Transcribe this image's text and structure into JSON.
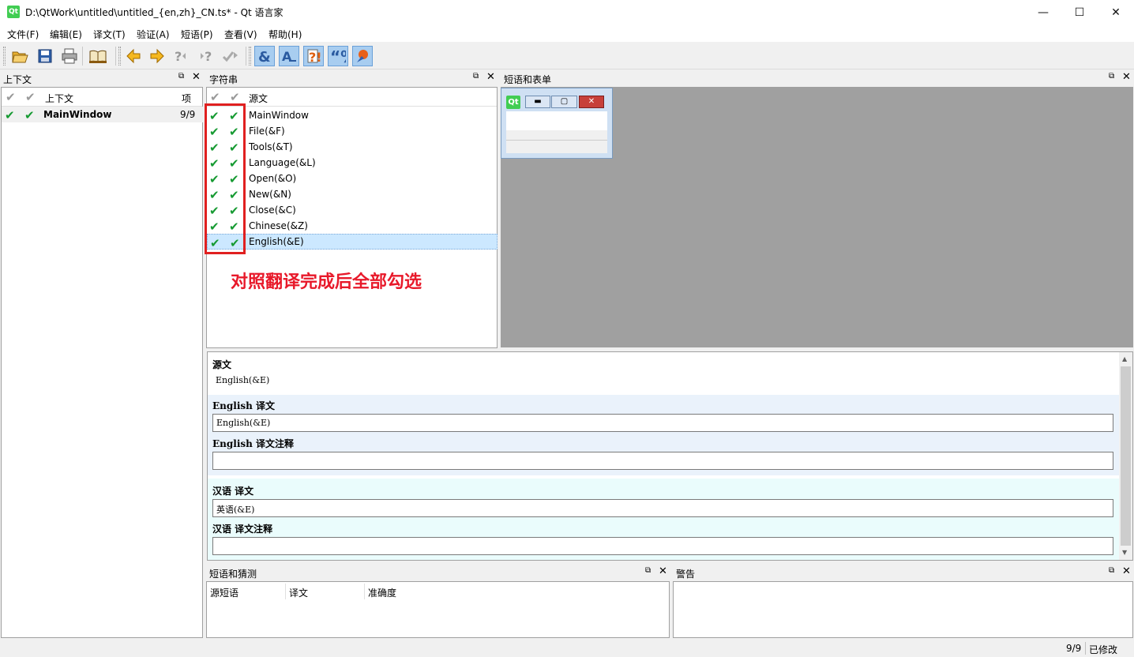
{
  "window": {
    "title": "D:\\QtWork\\untitled\\untitled_{en,zh}_CN.ts* - Qt 语言家",
    "app_icon_text": "Qt",
    "minimize": "—",
    "maximize": "☐",
    "close": "✕"
  },
  "menu": [
    "文件(F)",
    "编辑(E)",
    "译文(T)",
    "验证(A)",
    "短语(P)",
    "查看(V)",
    "帮助(H)"
  ],
  "toolbar": {
    "icons": [
      "open-icon",
      "save-icon",
      "print-icon",
      "phrasebook-icon",
      "prev-icon",
      "next-icon",
      "prev-unfinished-icon",
      "next-unfinished-icon",
      "done-next-icon",
      "accelerator-check-icon",
      "punctuation-check-icon",
      "phrase-check-icon",
      "placeholder-check-icon",
      "surrounding-whitespace-check-icon"
    ]
  },
  "context_panel": {
    "title": "上下文",
    "header_context": "上下文",
    "header_items": "项",
    "rows": [
      {
        "name": "MainWindow",
        "count": "9/9"
      }
    ]
  },
  "strings_panel": {
    "title": "字符串",
    "header_source": "源文",
    "rows": [
      "MainWindow",
      "File(&F)",
      "Tools(&T)",
      "Language(&L)",
      "Open(&O)",
      "New(&N)",
      "Close(&C)",
      "Chinese(&Z)",
      "English(&E)"
    ],
    "selected_index": 8
  },
  "annotation": "对照翻译完成后全部勾选",
  "phrases_forms": {
    "title": "短语和表单",
    "mini_icon": "Qt"
  },
  "editor": {
    "source_label": "源文",
    "source_text": "English(&E)",
    "en_translation_label": "English 译文",
    "en_translation": "English(&E)",
    "en_comment_label": "English 译文注释",
    "en_comment": "",
    "zh_translation_label": "汉语 译文",
    "zh_translation": "英语(&E)",
    "zh_comment_label": "汉语 译文注释",
    "zh_comment": ""
  },
  "guesses_panel": {
    "title": "短语和猜测",
    "col_source": "源短语",
    "col_translation": "译文",
    "col_accuracy": "准确度"
  },
  "warnings_panel": {
    "title": "警告"
  },
  "status": {
    "progress": "9/9",
    "modified": "已修改"
  }
}
